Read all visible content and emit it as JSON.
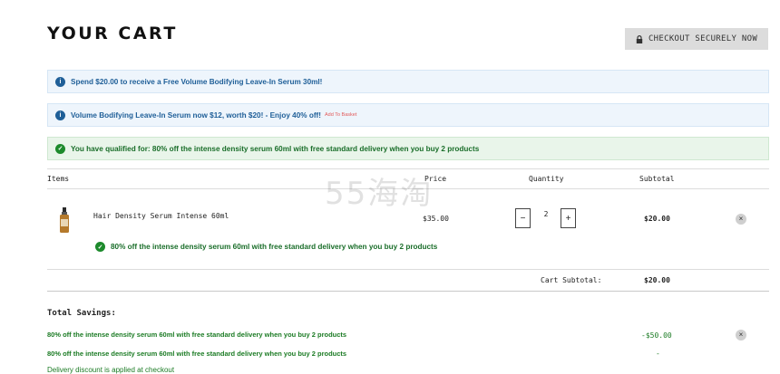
{
  "header": {
    "title": "YOUR CART",
    "checkout_label": "CHECKOUT SECURELY NOW"
  },
  "banners": [
    {
      "type": "info",
      "text": "Spend $20.00 to receive a Free Volume Bodifying Leave-In Serum 30ml!"
    },
    {
      "type": "info",
      "text": "Volume Bodifying Leave-In Serum now $12, worth $20! - Enjoy 40% off!",
      "link": "Add To Basket"
    },
    {
      "type": "success",
      "text": "You have qualified for: 80% off the intense density serum 60ml with free standard delivery when you buy 2 products"
    }
  ],
  "table": {
    "headers": {
      "items": "Items",
      "price": "Price",
      "quantity": "Quantity",
      "subtotal": "Subtotal"
    }
  },
  "cart_item": {
    "name": "Hair Density Serum Intense 60ml",
    "price": "$35.00",
    "quantity": "2",
    "subtotal": "$20.00",
    "promo": "80% off the intense density serum 60ml with free standard delivery when you buy 2 products"
  },
  "cart_subtotal": {
    "label": "Cart Subtotal:",
    "value": "$20.00"
  },
  "savings": {
    "heading": "Total Savings:",
    "rows": [
      {
        "text": "80% off the intense density serum 60ml with free standard delivery when you buy 2 products",
        "amount": "-$50.00"
      },
      {
        "text": "80% off the intense density serum 60ml with free standard delivery when you buy 2 products",
        "amount": "-"
      }
    ],
    "note": "Delivery discount is applied at checkout"
  },
  "watermark": "55海淘",
  "icons": {
    "lock": "lock-icon",
    "info": "info-icon",
    "check": "check-circle-icon",
    "remove": "remove-x-icon"
  },
  "colors": {
    "info_text": "#1f5f98",
    "success_text": "#1a6e2a",
    "savings_green": "#1b7b24",
    "add_link": "#e25a5a",
    "checkout_bg": "#dcdcdc"
  }
}
